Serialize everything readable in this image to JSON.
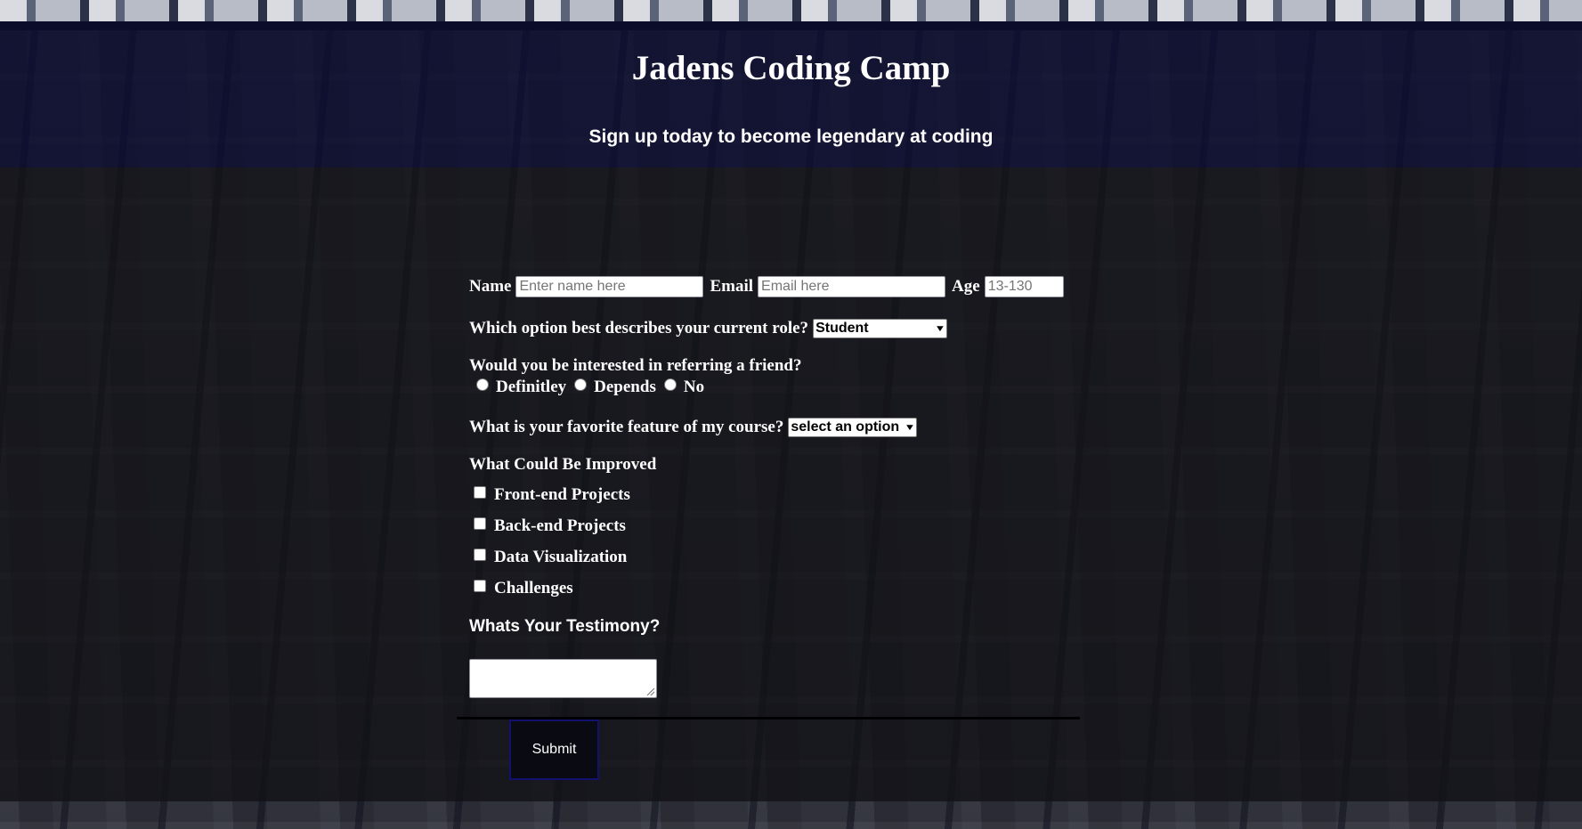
{
  "header": {
    "title": "Jadens Coding Camp",
    "subtitle": "Sign up today to become legendary at coding"
  },
  "form": {
    "name": {
      "label": "Name",
      "placeholder": "Enter name here",
      "value": ""
    },
    "email": {
      "label": "Email",
      "placeholder": "Email here",
      "value": ""
    },
    "age": {
      "label": "Age",
      "placeholder": "13-130",
      "value": ""
    },
    "role": {
      "question": "Which option best describes your current role?",
      "selected": "Student"
    },
    "referral": {
      "question": "Would you be interested in referring a friend?",
      "options": [
        "Definitley",
        "Depends",
        "No"
      ]
    },
    "favorite_feature": {
      "question": "What is your favorite feature of my course?",
      "selected": "select an option"
    },
    "improvements": {
      "heading": "What Could Be Improved",
      "options": [
        "Front-end Projects",
        "Back-end Projects",
        "Data Visualization",
        "Challenges"
      ]
    },
    "testimony": {
      "heading": "Whats Your Testimony?",
      "value": ""
    },
    "submit_label": "Submit"
  },
  "icons": {
    "select_arrow": "chevron-down-icon"
  }
}
